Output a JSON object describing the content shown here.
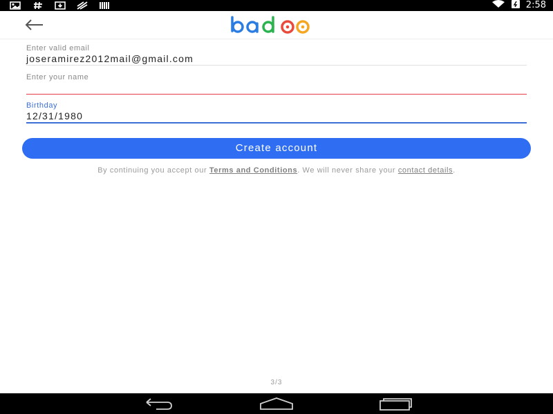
{
  "status_bar": {
    "time": "2:58",
    "icons_left": [
      "image-icon",
      "hash-icon",
      "download-icon",
      "cast-icon",
      "barcode-icon"
    ],
    "icons_right": [
      "wifi-icon",
      "battery-icon"
    ]
  },
  "app_bar": {
    "logo_text": "badoo",
    "logo_colors": [
      "#2b7de1",
      "#2b7de1",
      "#2ab34f",
      "#e94a3b",
      "#f5a623"
    ]
  },
  "form": {
    "email": {
      "label": "Enter valid email",
      "value": "joseramirez2012mail@gmail.com"
    },
    "name": {
      "placeholder": "Enter your name",
      "value": ""
    },
    "birthday": {
      "label": "Birthday",
      "value": "12/31/1980"
    }
  },
  "cta": {
    "label": "Create account",
    "color": "#2f6ef2"
  },
  "legal": {
    "prefix": "By continuing you accept our ",
    "terms": "Terms and Conditions",
    "middle": ". We will never share your ",
    "contact": "contact details",
    "suffix": "."
  },
  "pager": {
    "text": "3/3"
  },
  "nav_bar": {
    "buttons": [
      "back-icon",
      "home-icon",
      "recents-icon"
    ]
  }
}
